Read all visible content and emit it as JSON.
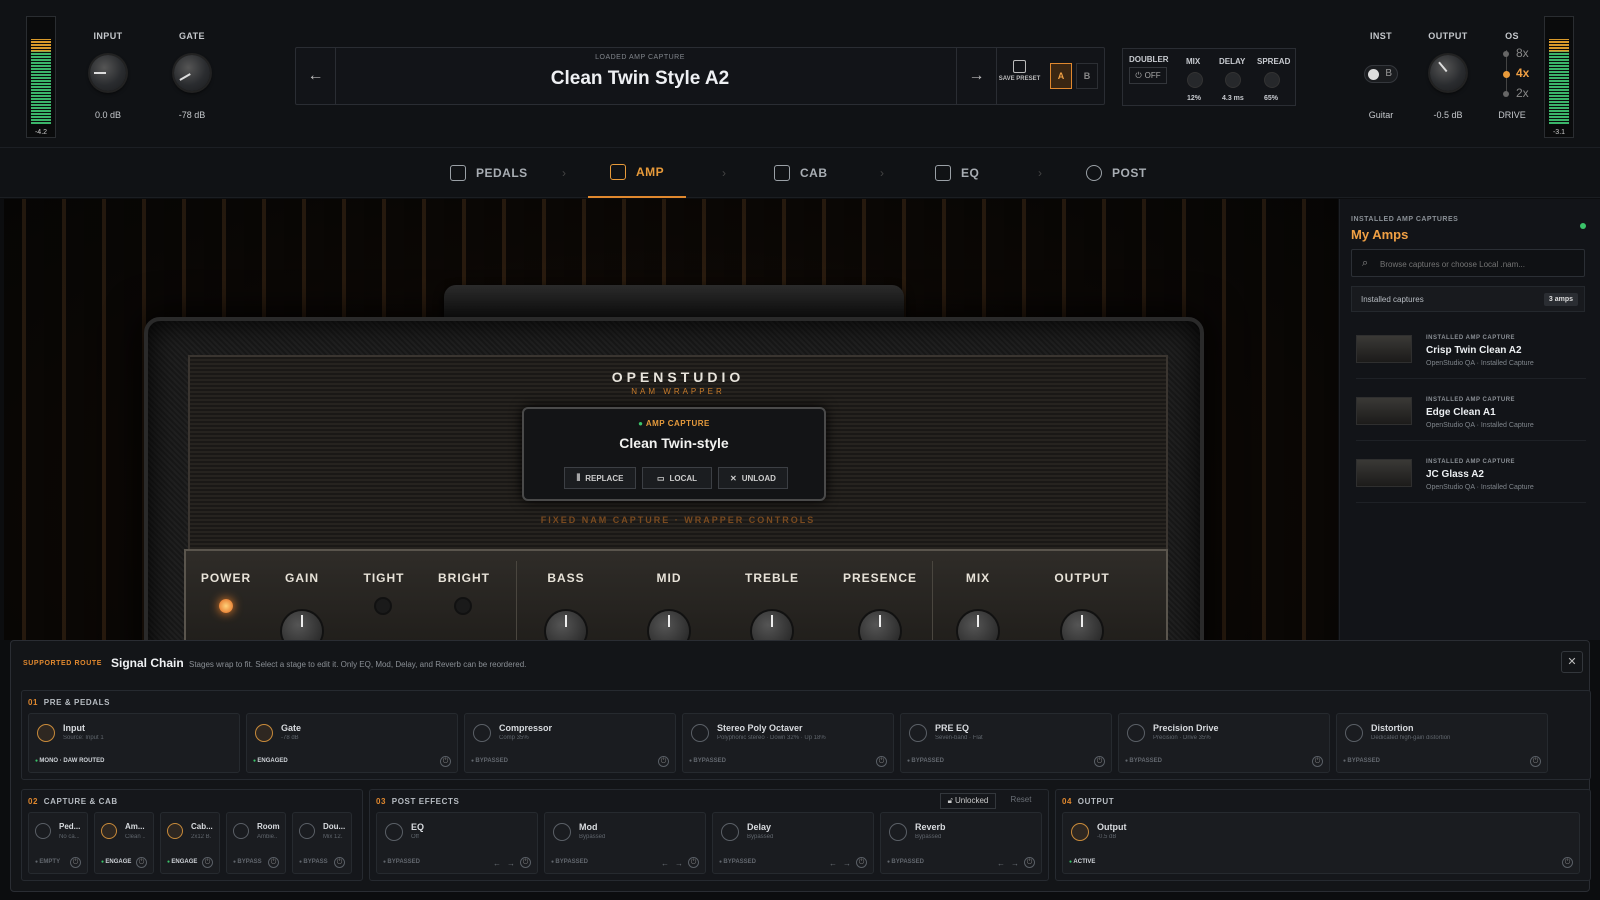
{
  "top": {
    "meter_left": "-4.2",
    "meter_right": "-3.1",
    "input_label": "INPUT",
    "input_value": "0.0 dB",
    "gate_label": "GATE",
    "gate_value": "-78 dB",
    "loaded_label": "LOADED AMP CAPTURE",
    "loaded_name": "Clean Twin Style A2",
    "save_label": "SAVE PRESET",
    "ab_a": "A",
    "ab_b": "B",
    "doubler_label": "DOUBLER",
    "doubler_state": "OFF",
    "mix_label": "MIX",
    "mix_value": "12%",
    "delay_label": "DELAY",
    "delay_value": "4.3 ms",
    "spread_label": "SPREAD",
    "spread_value": "65%",
    "inst_label": "INST",
    "inst_toggle": "B",
    "inst_value": "Guitar",
    "output_label": "OUTPUT",
    "output_value": "-0.5 dB",
    "os_label": "OS",
    "os_options": [
      "8x",
      "4x",
      "2x"
    ],
    "os_selected": "4x",
    "drive_label": "DRIVE"
  },
  "tabs": [
    "PEDALS",
    "AMP",
    "CAB",
    "EQ",
    "POST"
  ],
  "active_tab": "AMP",
  "amp": {
    "brand": "OPENSTUDIO",
    "sub": "NAM WRAPPER",
    "capture_tag": "AMP CAPTURE",
    "capture_name": "Clean Twin-style",
    "replace": "REPLACE",
    "local": "LOCAL",
    "unload": "UNLOAD",
    "fixed_note": "FIXED NAM CAPTURE · WRAPPER CONTROLS",
    "controls": [
      "POWER",
      "GAIN",
      "TIGHT",
      "BRIGHT",
      "BASS",
      "MID",
      "TREBLE",
      "PRESENCE",
      "MIX",
      "OUTPUT"
    ]
  },
  "sidebar": {
    "eyebrow": "INSTALLED AMP CAPTURES",
    "title": "My Amps",
    "search_placeholder": "Browse captures or choose Local .nam...",
    "installed_label": "Installed captures",
    "installed_count": "3 amps",
    "items": [
      {
        "sub": "INSTALLED AMP CAPTURE",
        "name": "Crisp Twin Clean A2",
        "meta": "OpenStudio QA · Installed Capture"
      },
      {
        "sub": "INSTALLED AMP CAPTURE",
        "name": "Edge Clean A1",
        "meta": "OpenStudio QA · Installed Capture"
      },
      {
        "sub": "INSTALLED AMP CAPTURE",
        "name": "JC Glass A2",
        "meta": "OpenStudio QA · Installed Capture"
      }
    ]
  },
  "chain": {
    "route": "SUPPORTED ROUTE",
    "title": "Signal Chain",
    "desc": "Stages wrap to fit. Select a stage to edit it. Only EQ, Mod, Delay, and Reverb can be reordered.",
    "sec1": {
      "num": "01",
      "title": "PRE & PEDALS",
      "cards": [
        {
          "t": "Input",
          "s": "Source: Input 1",
          "st": "MONO · DAW ROUTED",
          "eng": true
        },
        {
          "t": "Gate",
          "s": "-78 dB",
          "st": "ENGAGED",
          "eng": true
        },
        {
          "t": "Compressor",
          "s": "Comp 35%",
          "st": "BYPASSED",
          "eng": false
        },
        {
          "t": "Stereo Poly Octaver",
          "s": "Polyphonic stereo · Down 32% · Up 18%",
          "st": "BYPASSED",
          "eng": false
        },
        {
          "t": "PRE EQ",
          "s": "Seven-band · Flat",
          "st": "BYPASSED",
          "eng": false
        },
        {
          "t": "Precision Drive",
          "s": "Precision · Drive 35%",
          "st": "BYPASSED",
          "eng": false
        },
        {
          "t": "Distortion",
          "s": "Dedicated high-gain distortion",
          "st": "BYPASSED",
          "eng": false
        }
      ]
    },
    "sec2": {
      "num": "02",
      "title": "CAPTURE & CAB",
      "cards": [
        {
          "t": "Ped...",
          "s": "No ca...",
          "st": "EMPTY",
          "eng": false
        },
        {
          "t": "Am...",
          "s": "Clean ...",
          "st": "ENGAGE",
          "eng": true
        },
        {
          "t": "Cab...",
          "s": "2x12 B...",
          "st": "ENGAGE",
          "eng": true
        },
        {
          "t": "Room",
          "s": "Ambie...",
          "st": "BYPASS",
          "eng": false
        },
        {
          "t": "Dou...",
          "s": "Mix 12...",
          "st": "BYPASS",
          "eng": false
        }
      ]
    },
    "sec3": {
      "num": "03",
      "title": "POST EFFECTS",
      "unlocked": "Unlocked",
      "reset": "Reset",
      "cards": [
        {
          "t": "EQ",
          "s": "Off",
          "st": "BYPASSED",
          "eng": false
        },
        {
          "t": "Mod",
          "s": "Bypassed",
          "st": "BYPASSED",
          "eng": false
        },
        {
          "t": "Delay",
          "s": "Bypassed",
          "st": "BYPASSED",
          "eng": false
        },
        {
          "t": "Reverb",
          "s": "Bypassed",
          "st": "BYPASSED",
          "eng": false
        }
      ]
    },
    "sec4": {
      "num": "04",
      "title": "OUTPUT",
      "cards": [
        {
          "t": "Output",
          "s": "-0.5 dB",
          "st": "ACTIVE",
          "eng": true
        }
      ]
    }
  }
}
